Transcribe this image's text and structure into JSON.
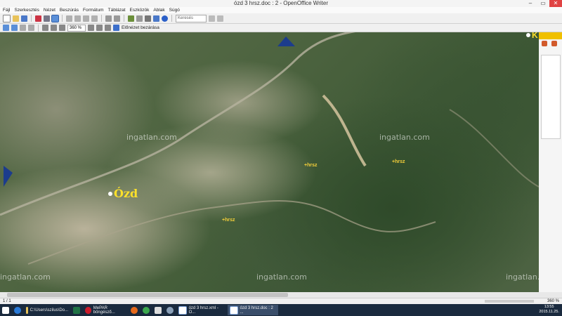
{
  "window": {
    "title": "ózd 3 hrsz.doc : 2 - OpenOffice Writer"
  },
  "menu": [
    "Fájl",
    "Szerkesztés",
    "Nézet",
    "Beszúrás",
    "Formátum",
    "Táblázat",
    "Eszközök",
    "Ablak",
    "Súgó"
  ],
  "toolbar": {
    "search_placeholder": "Keresés",
    "zoom_value": "360 %",
    "preview_label": "Előnézet bezárása"
  },
  "map": {
    "city_label": "Ózd",
    "corner_label": "K",
    "watermark": "ingatlan.com",
    "parcel_labels": [
      "hrsz",
      "hrsz",
      "hrsz"
    ]
  },
  "statusbar": {
    "page": "1 / 1",
    "zoom": "360 %"
  },
  "taskbar": {
    "items": [
      {
        "label": "",
        "icon": "start-icon"
      },
      {
        "label": "",
        "icon": "internet-explorer-icon"
      },
      {
        "label": "C:\\Users\\szilus\\Do...",
        "icon": "folder-icon"
      },
      {
        "label": "",
        "icon": "excel-icon"
      },
      {
        "label": "MePAR böngésző...",
        "icon": "opera-icon"
      },
      {
        "label": "",
        "icon": "firefox-icon"
      },
      {
        "label": "",
        "icon": "chrome-icon"
      },
      {
        "label": "",
        "icon": "calculator-icon"
      },
      {
        "label": "",
        "icon": "globe-icon"
      },
      {
        "label": "ózd 3 hrsz.xml - O...",
        "icon": "writer-icon"
      },
      {
        "label": "ózd 3 hrsz.doc : 2 ...",
        "icon": "writer-icon"
      }
    ],
    "time": "13:55",
    "date": "2015.11.25."
  },
  "colors": {
    "accent": "#2e5eaa",
    "map_label": "#ffe12a",
    "parcel": "#f6d03a",
    "taskbar": "#1a2a3e"
  }
}
